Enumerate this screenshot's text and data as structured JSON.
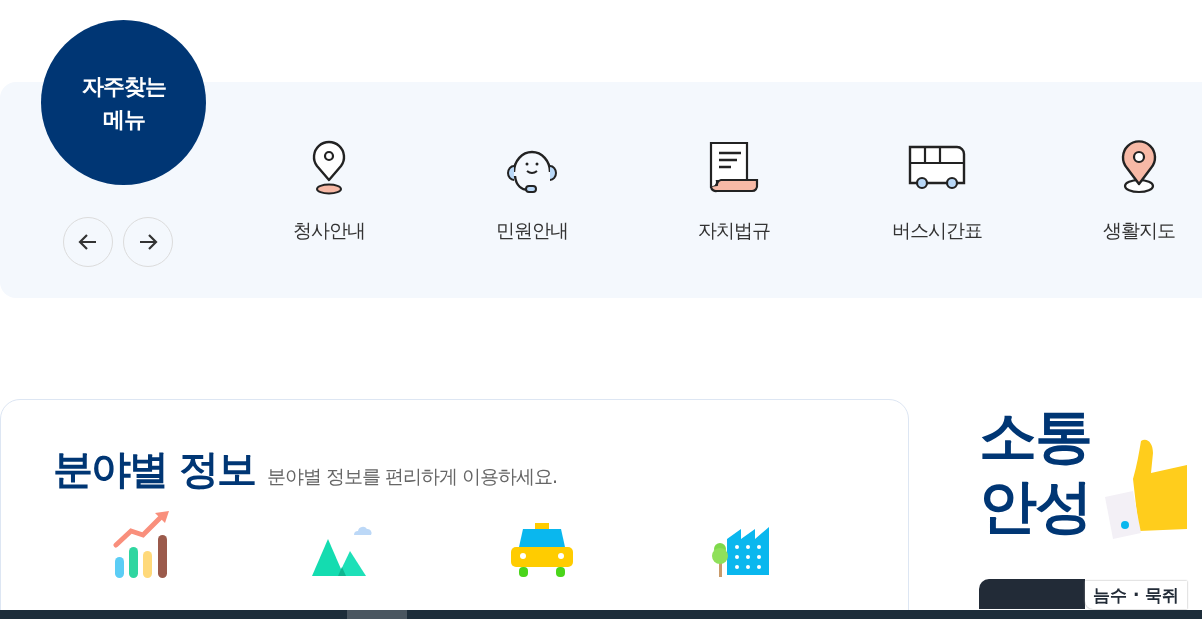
{
  "quick_menu": {
    "badge_lines": [
      "자주찾는",
      "메뉴"
    ],
    "items": [
      {
        "kind": "pin",
        "label": "청사안내"
      },
      {
        "kind": "headset",
        "label": "민원안내"
      },
      {
        "kind": "document",
        "label": "자치법규"
      },
      {
        "kind": "bus",
        "label": "버스시간표"
      },
      {
        "kind": "map-pin",
        "label": "생활지도"
      }
    ]
  },
  "field_info": {
    "title": "분야별 정보",
    "subtitle": "분야별 정보를 편리하게 이용하세요.",
    "categories": [
      {
        "kind": "chart"
      },
      {
        "kind": "mountain"
      },
      {
        "kind": "taxi"
      },
      {
        "kind": "factory"
      }
    ]
  },
  "banner": {
    "title": "소통\n안성"
  },
  "bottom_tabs": [
    {
      "selected": true
    },
    {
      "label": "늠수 · 묵쥐",
      "selected": false
    }
  ]
}
